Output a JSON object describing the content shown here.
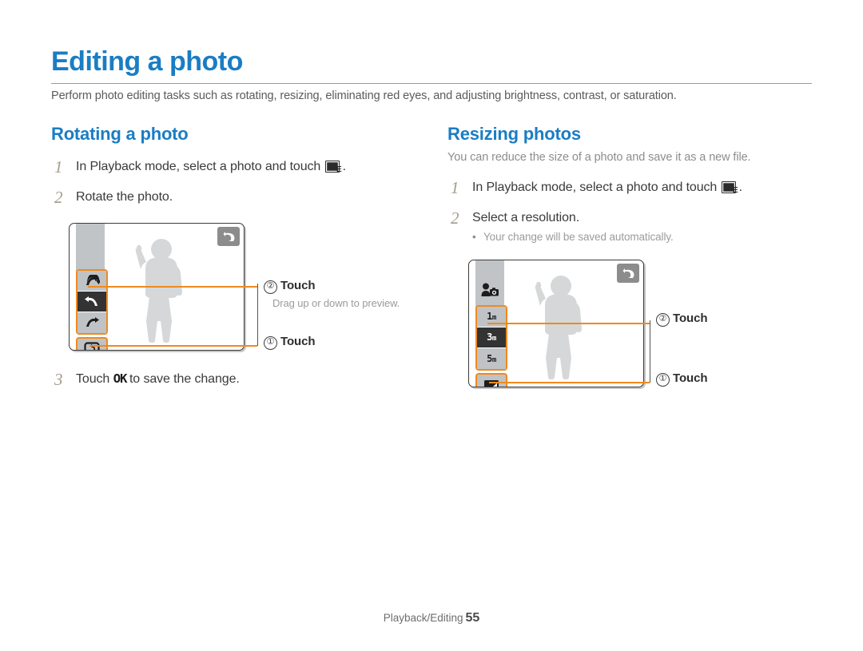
{
  "header": {
    "title": "Editing a photo",
    "intro": "Perform photo editing tasks such as rotating, resizing, eliminating red eyes, and adjusting brightness, contrast, or saturation.",
    "title_color": "#1a7dc4"
  },
  "left_section": {
    "heading": "Rotating a photo",
    "steps": [
      {
        "num": "1",
        "text_before": "In Playback mode, select a photo and touch ",
        "icon": "edit-mode-icon",
        "text_after": "."
      },
      {
        "num": "2",
        "text_before": "Rotate the photo.",
        "icon": "",
        "text_after": ""
      },
      {
        "num": "3",
        "text_before": "Touch ",
        "icon": "ok-button-icon",
        "icon_text": "OK",
        "text_after": " to save the change."
      }
    ],
    "screen": {
      "back_icon": "back-arrow-icon",
      "menu_items": [
        {
          "icon": "rotate-right-down-icon",
          "selected": false
        },
        {
          "icon": "rotate-left-icon",
          "selected": true
        },
        {
          "icon": "rotate-right-icon",
          "selected": false
        }
      ],
      "bottom_button": {
        "icon": "rotate-confirm-icon"
      }
    },
    "callouts": [
      {
        "circnum": "②",
        "label": "Touch",
        "note": "Drag up or down to preview."
      },
      {
        "circnum": "①",
        "label": "Touch",
        "note": ""
      }
    ]
  },
  "right_section": {
    "heading": "Resizing photos",
    "subtitle": "You can reduce the size of a photo and save it as a new file.",
    "steps": [
      {
        "num": "1",
        "text_before": "In Playback mode, select a photo and touch ",
        "icon": "edit-mode-icon",
        "text_after": "."
      },
      {
        "num": "2",
        "text_before": "Select a resolution.",
        "icon": "",
        "text_after": "",
        "bullet": "Your change will be saved automatically."
      }
    ],
    "screen": {
      "back_icon": "back-arrow-icon",
      "top_icon": "person-camera-icon",
      "menu_items": [
        {
          "label": "1",
          "unit": "m",
          "selected": false
        },
        {
          "label": "3",
          "unit": "m",
          "selected": true
        },
        {
          "label": "5",
          "unit": "m",
          "selected": false
        }
      ],
      "bottom_button": {
        "icon": "resize-icon"
      }
    },
    "callouts": [
      {
        "circnum": "②",
        "label": "Touch",
        "note": ""
      },
      {
        "circnum": "①",
        "label": "Touch",
        "note": ""
      }
    ]
  },
  "footer": {
    "section": "Playback/Editing",
    "page": "55"
  },
  "colors": {
    "accent": "#1a7dc4",
    "callout_line": "#f08a1e",
    "selected_bg": "#333333",
    "button_bg": "#bfc3c6"
  }
}
